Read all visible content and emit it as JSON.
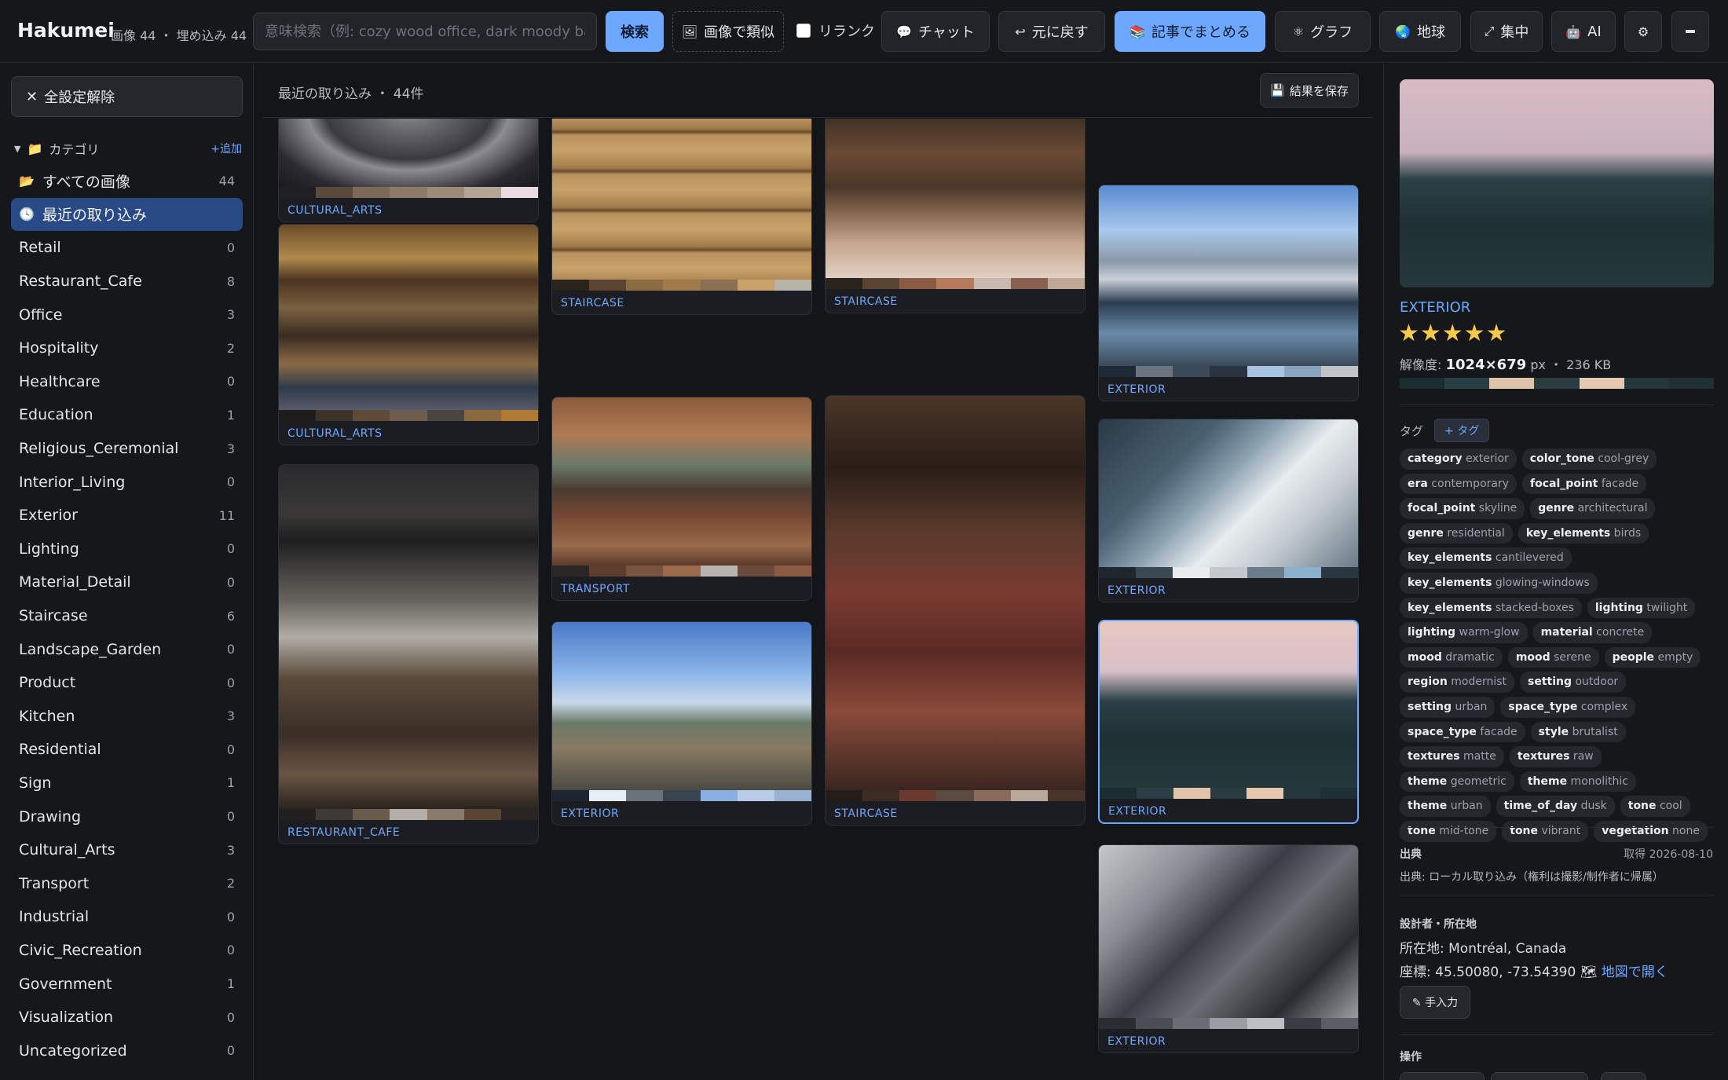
{
  "header": {
    "brand": "Hakumei",
    "counts": "画像 44 ・ 埋め込み 44",
    "search_placeholder": "意味検索（例: cozy wood office, dark moody bathro",
    "search_button": "検索",
    "similar_button": "画像で類似",
    "rerank_label": "リランク",
    "chat_button": "チャット",
    "undo_button": "元に戻す",
    "article_button": "記事でまとめる",
    "graph_button": "グラフ",
    "earth_button": "地球",
    "focus_button": "集中",
    "ai_button": "AI"
  },
  "sidebar": {
    "clear_label": "全設定解除",
    "categories_title": "カテゴリ",
    "add_label": "+追加",
    "items": [
      {
        "label": "すべての画像",
        "count": "44"
      },
      {
        "label": "最近の取り込み",
        "count": ""
      },
      {
        "label": "Retail",
        "count": "0"
      },
      {
        "label": "Restaurant_Cafe",
        "count": "8"
      },
      {
        "label": "Office",
        "count": "3"
      },
      {
        "label": "Hospitality",
        "count": "2"
      },
      {
        "label": "Healthcare",
        "count": "0"
      },
      {
        "label": "Education",
        "count": "1"
      },
      {
        "label": "Religious_Ceremonial",
        "count": "3"
      },
      {
        "label": "Interior_Living",
        "count": "0"
      },
      {
        "label": "Exterior",
        "count": "11"
      },
      {
        "label": "Lighting",
        "count": "0"
      },
      {
        "label": "Material_Detail",
        "count": "0"
      },
      {
        "label": "Staircase",
        "count": "6"
      },
      {
        "label": "Landscape_Garden",
        "count": "0"
      },
      {
        "label": "Product",
        "count": "0"
      },
      {
        "label": "Kitchen",
        "count": "3"
      },
      {
        "label": "Residential",
        "count": "0"
      },
      {
        "label": "Sign",
        "count": "1"
      },
      {
        "label": "Drawing",
        "count": "0"
      },
      {
        "label": "Cultural_Arts",
        "count": "3"
      },
      {
        "label": "Transport",
        "count": "2"
      },
      {
        "label": "Industrial",
        "count": "0"
      },
      {
        "label": "Civic_Recreation",
        "count": "0"
      },
      {
        "label": "Government",
        "count": "1"
      },
      {
        "label": "Visualization",
        "count": "0"
      },
      {
        "label": "Uncategorized",
        "count": "0"
      }
    ]
  },
  "main": {
    "heading": "最近の取り込み ・ 44件",
    "save_button": "結果を保存",
    "cards": [
      {
        "label": "CULTURAL_ARTS",
        "palette": [
          "#1f1f24",
          "#5a4a3e",
          "#7a6a57",
          "#8c7a66",
          "#9c8b78",
          "#b4a493",
          "#e9dbe0"
        ]
      },
      {
        "label": "CULTURAL_ARTS",
        "palette": [
          "#1f1d1c",
          "#3d3229",
          "#5e4a37",
          "#6d5d4d",
          "#4a4540",
          "#8a6a3c",
          "#b07a34"
        ]
      },
      {
        "label": "RESTAURANT_CAFE",
        "palette": [
          "#22201e",
          "#3f3a35",
          "#6a5a4a",
          "#b3aea8",
          "#8a7a6a",
          "#5a4532",
          "#2a2522"
        ]
      },
      {
        "label": "STAIRCASE",
        "palette": [
          "#2b241c",
          "#5a4630",
          "#8c6a42",
          "#a07a4a",
          "#8a7050",
          "#c9a26a",
          "#b8b3a8"
        ]
      },
      {
        "label": "TRANSPORT",
        "palette": [
          "#2a2624",
          "#5c3d2e",
          "#7a5340",
          "#9a6a4a",
          "#b8b3ae",
          "#6a4a3a",
          "#8a5a42"
        ]
      },
      {
        "label": "EXTERIOR",
        "palette": [
          "#1e2530",
          "#e8eef6",
          "#6a727c",
          "#3a4450",
          "#8ab0e0",
          "#b8cce8",
          "#9ab2d2"
        ]
      },
      {
        "label": "STAIRCASE",
        "palette": [
          "#2a231e",
          "#5a4535",
          "#8a5a42",
          "#b57a5a",
          "#c8b8b0",
          "#8a6050",
          "#c0a898"
        ]
      },
      {
        "label": "STAIRCASE",
        "palette": [
          "#241c18",
          "#3d2c24",
          "#6a3a30",
          "#5a4a42",
          "#8a6a58",
          "#b8a89a",
          "#4a342a"
        ]
      },
      {
        "label": "EXTERIOR",
        "palette": [
          "#1e2a38",
          "#6a7480",
          "#3a4a58",
          "#2a3440",
          "#a8c4e0",
          "#8aa4c0",
          "#c0c4c8"
        ]
      },
      {
        "label": "EXTERIOR",
        "palette": [
          "#1e262e",
          "#3a4852",
          "#e8eaec",
          "#c4c8cc",
          "#6a7c8a",
          "#8ab0cc",
          "#2a3640"
        ]
      },
      {
        "label": "EXTERIOR",
        "palette": [
          "#1a2e32",
          "#2a4046",
          "#e0c4aa",
          "#2a3c40",
          "#e6c8ae",
          "#24383c",
          "#1e3034"
        ]
      },
      {
        "label": "EXTERIOR",
        "palette": [
          "#2a2c30",
          "#4a4e54",
          "#6a6e74",
          "#9a9ea4",
          "#bcc0c4",
          "#3a3e44",
          "#5a5e64"
        ]
      }
    ]
  },
  "detail": {
    "category": "EXTERIOR",
    "rating": 5,
    "stars_text": "★★★★★",
    "resolution_label": "解像度:",
    "resolution": "1024×679",
    "resolution_unit": "px ・ 236 KB",
    "palette": [
      "#1a2e32",
      "#2a4046",
      "#e0c4aa",
      "#2a3c40",
      "#e6c8ae",
      "#24383c",
      "#1e3034"
    ],
    "tags_title": "タグ",
    "tag_add": "+ タグ",
    "tags": [
      {
        "k": "category",
        "v": "exterior"
      },
      {
        "k": "color_tone",
        "v": "cool-grey"
      },
      {
        "k": "era",
        "v": "contemporary"
      },
      {
        "k": "focal_point",
        "v": "facade"
      },
      {
        "k": "focal_point",
        "v": "skyline"
      },
      {
        "k": "genre",
        "v": "architectural"
      },
      {
        "k": "genre",
        "v": "residential"
      },
      {
        "k": "key_elements",
        "v": "birds"
      },
      {
        "k": "key_elements",
        "v": "cantilevered"
      },
      {
        "k": "key_elements",
        "v": "glowing-windows"
      },
      {
        "k": "key_elements",
        "v": "stacked-boxes"
      },
      {
        "k": "lighting",
        "v": "twilight"
      },
      {
        "k": "lighting",
        "v": "warm-glow"
      },
      {
        "k": "material",
        "v": "concrete"
      },
      {
        "k": "mood",
        "v": "dramatic"
      },
      {
        "k": "mood",
        "v": "serene"
      },
      {
        "k": "people",
        "v": "empty"
      },
      {
        "k": "region",
        "v": "modernist"
      },
      {
        "k": "setting",
        "v": "outdoor"
      },
      {
        "k": "setting",
        "v": "urban"
      },
      {
        "k": "space_type",
        "v": "complex"
      },
      {
        "k": "space_type",
        "v": "facade"
      },
      {
        "k": "style",
        "v": "brutalist"
      },
      {
        "k": "textures",
        "v": "matte"
      },
      {
        "k": "textures",
        "v": "raw"
      },
      {
        "k": "theme",
        "v": "geometric"
      },
      {
        "k": "theme",
        "v": "monolithic"
      },
      {
        "k": "theme",
        "v": "urban"
      },
      {
        "k": "time_of_day",
        "v": "dusk"
      },
      {
        "k": "tone",
        "v": "cool"
      },
      {
        "k": "tone",
        "v": "mid-tone"
      },
      {
        "k": "tone",
        "v": "vibrant"
      },
      {
        "k": "vegetation",
        "v": "none"
      }
    ],
    "source_title": "出典",
    "source_date": "取得 2026-08-10",
    "source_text": "出典: ローカル取り込み（権利は撮影/制作者に帰属）",
    "designer_title": "設計者・所在地",
    "location": "所在地: Montréal, Canada",
    "coords": "座標: 45.50080, -73.54390",
    "map_link": "地図で開く",
    "manual_button": "✎ 手入力",
    "ops_title": "操作"
  },
  "colors": {
    "accent": "#6ea8fe",
    "active_bg": "#2a4a86",
    "star": "#f7c948"
  }
}
